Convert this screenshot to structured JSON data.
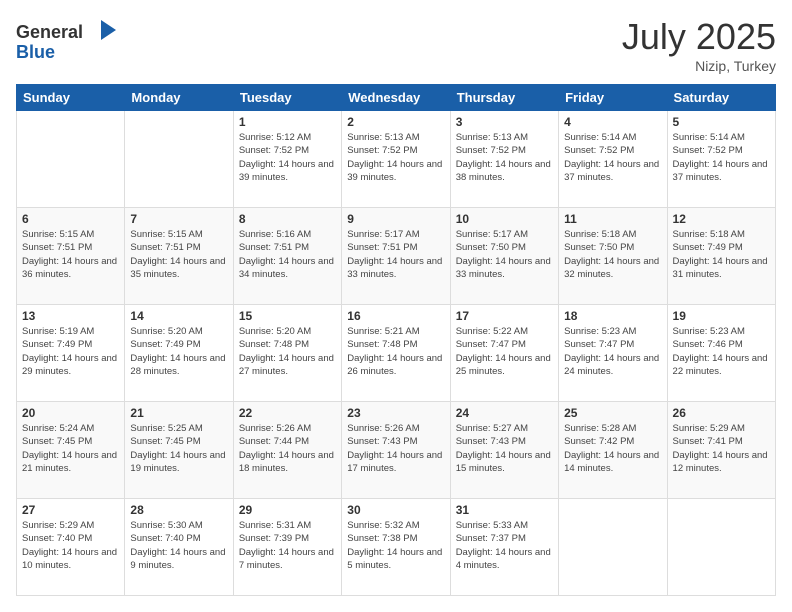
{
  "logo": {
    "line1": "General",
    "line2": "Blue"
  },
  "title": "July 2025",
  "subtitle": "Nizip, Turkey",
  "days_header": [
    "Sunday",
    "Monday",
    "Tuesday",
    "Wednesday",
    "Thursday",
    "Friday",
    "Saturday"
  ],
  "weeks": [
    [
      {
        "day": "",
        "info": ""
      },
      {
        "day": "",
        "info": ""
      },
      {
        "day": "1",
        "info": "Sunrise: 5:12 AM\nSunset: 7:52 PM\nDaylight: 14 hours and 39 minutes."
      },
      {
        "day": "2",
        "info": "Sunrise: 5:13 AM\nSunset: 7:52 PM\nDaylight: 14 hours and 39 minutes."
      },
      {
        "day": "3",
        "info": "Sunrise: 5:13 AM\nSunset: 7:52 PM\nDaylight: 14 hours and 38 minutes."
      },
      {
        "day": "4",
        "info": "Sunrise: 5:14 AM\nSunset: 7:52 PM\nDaylight: 14 hours and 37 minutes."
      },
      {
        "day": "5",
        "info": "Sunrise: 5:14 AM\nSunset: 7:52 PM\nDaylight: 14 hours and 37 minutes."
      }
    ],
    [
      {
        "day": "6",
        "info": "Sunrise: 5:15 AM\nSunset: 7:51 PM\nDaylight: 14 hours and 36 minutes."
      },
      {
        "day": "7",
        "info": "Sunrise: 5:15 AM\nSunset: 7:51 PM\nDaylight: 14 hours and 35 minutes."
      },
      {
        "day": "8",
        "info": "Sunrise: 5:16 AM\nSunset: 7:51 PM\nDaylight: 14 hours and 34 minutes."
      },
      {
        "day": "9",
        "info": "Sunrise: 5:17 AM\nSunset: 7:51 PM\nDaylight: 14 hours and 33 minutes."
      },
      {
        "day": "10",
        "info": "Sunrise: 5:17 AM\nSunset: 7:50 PM\nDaylight: 14 hours and 33 minutes."
      },
      {
        "day": "11",
        "info": "Sunrise: 5:18 AM\nSunset: 7:50 PM\nDaylight: 14 hours and 32 minutes."
      },
      {
        "day": "12",
        "info": "Sunrise: 5:18 AM\nSunset: 7:49 PM\nDaylight: 14 hours and 31 minutes."
      }
    ],
    [
      {
        "day": "13",
        "info": "Sunrise: 5:19 AM\nSunset: 7:49 PM\nDaylight: 14 hours and 29 minutes."
      },
      {
        "day": "14",
        "info": "Sunrise: 5:20 AM\nSunset: 7:49 PM\nDaylight: 14 hours and 28 minutes."
      },
      {
        "day": "15",
        "info": "Sunrise: 5:20 AM\nSunset: 7:48 PM\nDaylight: 14 hours and 27 minutes."
      },
      {
        "day": "16",
        "info": "Sunrise: 5:21 AM\nSunset: 7:48 PM\nDaylight: 14 hours and 26 minutes."
      },
      {
        "day": "17",
        "info": "Sunrise: 5:22 AM\nSunset: 7:47 PM\nDaylight: 14 hours and 25 minutes."
      },
      {
        "day": "18",
        "info": "Sunrise: 5:23 AM\nSunset: 7:47 PM\nDaylight: 14 hours and 24 minutes."
      },
      {
        "day": "19",
        "info": "Sunrise: 5:23 AM\nSunset: 7:46 PM\nDaylight: 14 hours and 22 minutes."
      }
    ],
    [
      {
        "day": "20",
        "info": "Sunrise: 5:24 AM\nSunset: 7:45 PM\nDaylight: 14 hours and 21 minutes."
      },
      {
        "day": "21",
        "info": "Sunrise: 5:25 AM\nSunset: 7:45 PM\nDaylight: 14 hours and 19 minutes."
      },
      {
        "day": "22",
        "info": "Sunrise: 5:26 AM\nSunset: 7:44 PM\nDaylight: 14 hours and 18 minutes."
      },
      {
        "day": "23",
        "info": "Sunrise: 5:26 AM\nSunset: 7:43 PM\nDaylight: 14 hours and 17 minutes."
      },
      {
        "day": "24",
        "info": "Sunrise: 5:27 AM\nSunset: 7:43 PM\nDaylight: 14 hours and 15 minutes."
      },
      {
        "day": "25",
        "info": "Sunrise: 5:28 AM\nSunset: 7:42 PM\nDaylight: 14 hours and 14 minutes."
      },
      {
        "day": "26",
        "info": "Sunrise: 5:29 AM\nSunset: 7:41 PM\nDaylight: 14 hours and 12 minutes."
      }
    ],
    [
      {
        "day": "27",
        "info": "Sunrise: 5:29 AM\nSunset: 7:40 PM\nDaylight: 14 hours and 10 minutes."
      },
      {
        "day": "28",
        "info": "Sunrise: 5:30 AM\nSunset: 7:40 PM\nDaylight: 14 hours and 9 minutes."
      },
      {
        "day": "29",
        "info": "Sunrise: 5:31 AM\nSunset: 7:39 PM\nDaylight: 14 hours and 7 minutes."
      },
      {
        "day": "30",
        "info": "Sunrise: 5:32 AM\nSunset: 7:38 PM\nDaylight: 14 hours and 5 minutes."
      },
      {
        "day": "31",
        "info": "Sunrise: 5:33 AM\nSunset: 7:37 PM\nDaylight: 14 hours and 4 minutes."
      },
      {
        "day": "",
        "info": ""
      },
      {
        "day": "",
        "info": ""
      }
    ]
  ]
}
